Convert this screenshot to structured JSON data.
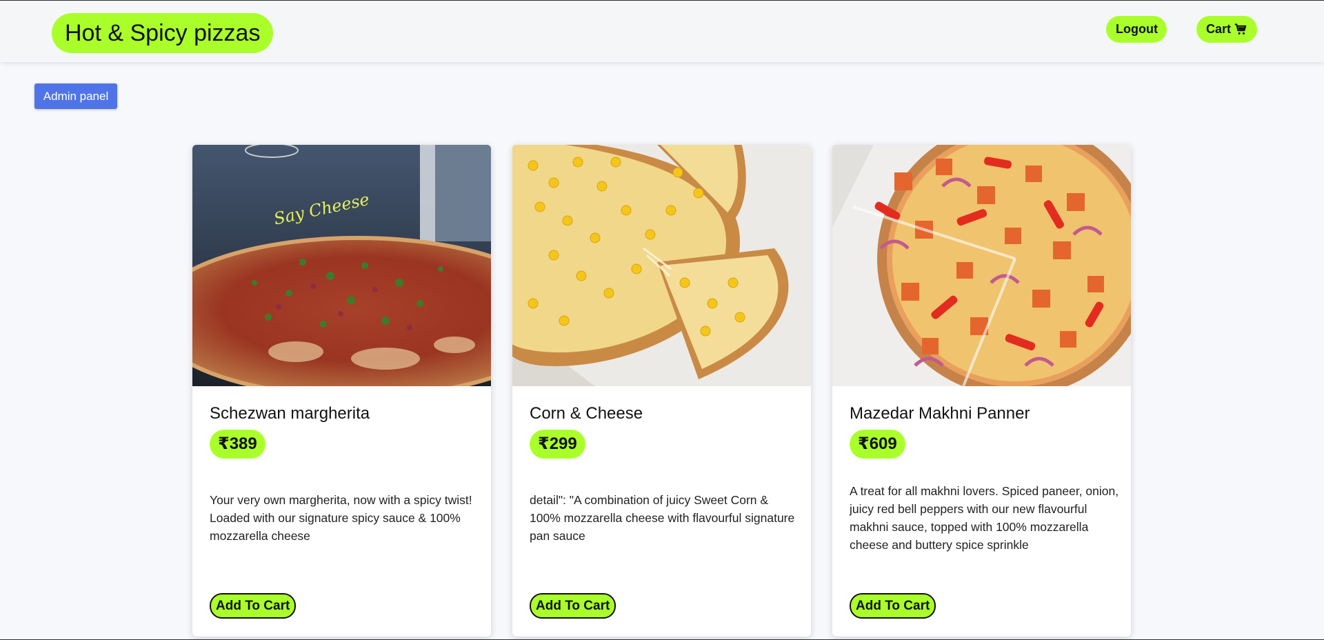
{
  "header": {
    "brand": "Hot & Spicy pizzas",
    "logout_label": "Logout",
    "cart_label": "Cart"
  },
  "admin_button_label": "Admin panel",
  "products": [
    {
      "name": "Schezwan margherita",
      "price": "₹389",
      "description": "Your very own margherita, now with a spicy twist! Loaded with our signature spicy sauce & 100% mozzarella cheese",
      "button_label": "Add To Cart"
    },
    {
      "name": "Corn & Cheese",
      "price": "₹299",
      "description": "detail\": \"A combination of juicy Sweet Corn & 100% mozzarella cheese with flavourful signature pan sauce",
      "button_label": "Add To Cart"
    },
    {
      "name": "Mazedar Makhni Panner",
      "price": "₹609",
      "description": "A treat for all makhni lovers. Spiced paneer, onion, juicy red bell peppers with our new flavourful makhni sauce, topped with 100% mozzarella cheese and buttery spice sprinkle",
      "button_label": "Add To Cart"
    }
  ],
  "image_lettering": "Say Cheese",
  "colors": {
    "accent_green": "#aaff2b",
    "admin_blue": "#4f74e8",
    "page_background": "#f7f8fc"
  },
  "icons": {
    "cart": "shopping-cart-icon"
  }
}
